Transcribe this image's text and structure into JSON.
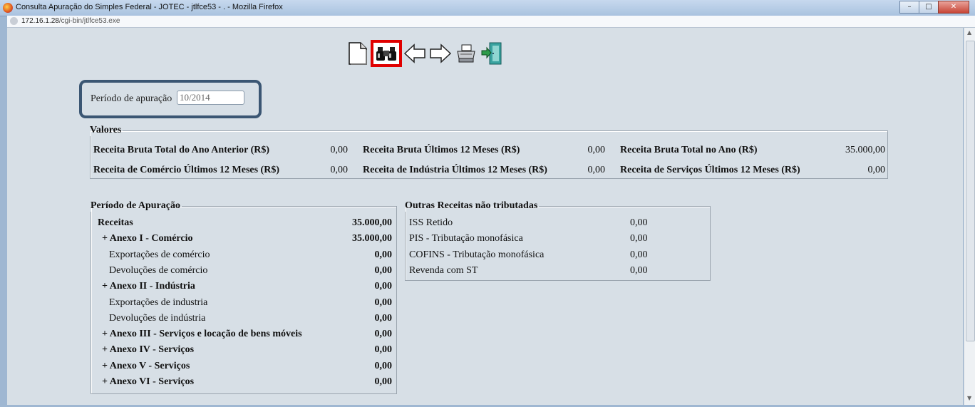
{
  "window": {
    "title": "Consulta Apuração do Simples Federal - JOTEC - jtlfce53 - . - Mozilla Firefox"
  },
  "browser": {
    "url_host": "172.16.1.28",
    "url_path": "/cgi-bin/jtlfce53.exe"
  },
  "toolbar": {
    "items": [
      {
        "icon": "new-document-icon"
      },
      {
        "icon": "binoculars-search-icon",
        "selected": true
      },
      {
        "icon": "arrow-left-icon"
      },
      {
        "icon": "arrow-right-icon"
      },
      {
        "icon": "printer-icon"
      },
      {
        "icon": "exit-door-icon"
      }
    ]
  },
  "periodo": {
    "label": "Período de apuração",
    "value": "10/2014"
  },
  "valores": {
    "legend": "Valores",
    "rows": [
      [
        {
          "label": "Receita Bruta Total do Ano Anterior (R$)",
          "value": "0,00"
        },
        {
          "label": "Receita Bruta Últimos 12 Meses (R$)",
          "value": "0,00"
        },
        {
          "label": "Receita Bruta Total no Ano (R$)",
          "value": "35.000,00"
        }
      ],
      [
        {
          "label": "Receita de Comércio Últimos 12 Meses (R$)",
          "value": "0,00"
        },
        {
          "label": "Receita de Indústria Últimos 12 Meses (R$)",
          "value": "0,00"
        },
        {
          "label": "Receita de Serviços Últimos 12 Meses (R$)",
          "value": "0,00"
        }
      ]
    ]
  },
  "apuracao": {
    "legend": "Período de Apuração",
    "rows": [
      {
        "label": "Receitas",
        "value": "35.000,00",
        "bold": true,
        "indent": 0
      },
      {
        "label": "+ Anexo I - Comércio",
        "value": "35.000,00",
        "bold": true,
        "indent": 1
      },
      {
        "label": "Exportações de comércio",
        "value": "0,00",
        "bold": false,
        "indent": 2
      },
      {
        "label": "Devoluções de comércio",
        "value": "0,00",
        "bold": false,
        "indent": 2
      },
      {
        "label": "+ Anexo II - Indústria",
        "value": "0,00",
        "bold": true,
        "indent": 1
      },
      {
        "label": "Exportações de industria",
        "value": "0,00",
        "bold": false,
        "indent": 2
      },
      {
        "label": "Devoluções de indústria",
        "value": "0,00",
        "bold": false,
        "indent": 2
      },
      {
        "label": "+ Anexo III - Serviços e locação de bens móveis",
        "value": "0,00",
        "bold": true,
        "indent": 1
      },
      {
        "label": "+ Anexo IV - Serviços",
        "value": "0,00",
        "bold": true,
        "indent": 1
      },
      {
        "label": "+ Anexo V - Serviços",
        "value": "0,00",
        "bold": true,
        "indent": 1
      },
      {
        "label": "+ Anexo VI - Serviços",
        "value": "0,00",
        "bold": true,
        "indent": 1
      }
    ]
  },
  "outras": {
    "legend": "Outras Receitas não tributadas",
    "rows": [
      {
        "label": "ISS Retido",
        "value": "0,00"
      },
      {
        "label": "PIS - Tributação monofásica",
        "value": "0,00"
      },
      {
        "label": "COFINS - Tributação monofásica",
        "value": "0,00"
      },
      {
        "label": "Revenda com ST",
        "value": "0,00"
      }
    ]
  },
  "colors": {
    "highlight_selected": "#e00000",
    "periodo_frame": "#3b5673",
    "page_bg": "#d7dfe6"
  }
}
